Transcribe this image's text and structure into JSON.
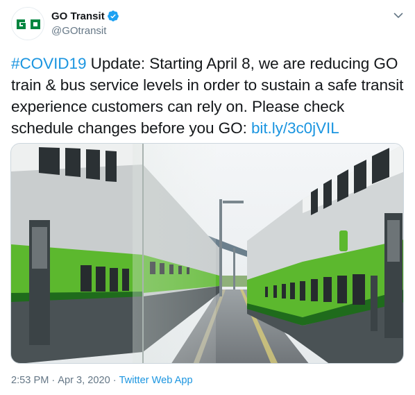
{
  "author": {
    "display_name": "GO Transit",
    "handle": "@GOtransit",
    "avatar_text": "GO",
    "verified": true,
    "brand_color": "#00853f"
  },
  "tweet": {
    "hashtag": "#COVID19",
    "body": " Update: Starting April 8, we are reducing GO train & bus service levels in order to sustain a safe transit experience customers can rely on. Please check schedule changes before you GO: ",
    "link": "bit.ly/3c0jVIL"
  },
  "media": {
    "alt": "Two GO trains on either side of a station platform"
  },
  "meta": {
    "time": "2:53 PM",
    "separator": "·",
    "date": "Apr 3, 2020",
    "source": "Twitter Web App"
  },
  "icons": {
    "verified": "verified-badge-icon",
    "caret": "chevron-down-icon"
  },
  "colors": {
    "link": "#1b95e0",
    "secondary_text": "#657786",
    "verified_blue": "#1da1f2",
    "train_green": "#5cb82e"
  }
}
